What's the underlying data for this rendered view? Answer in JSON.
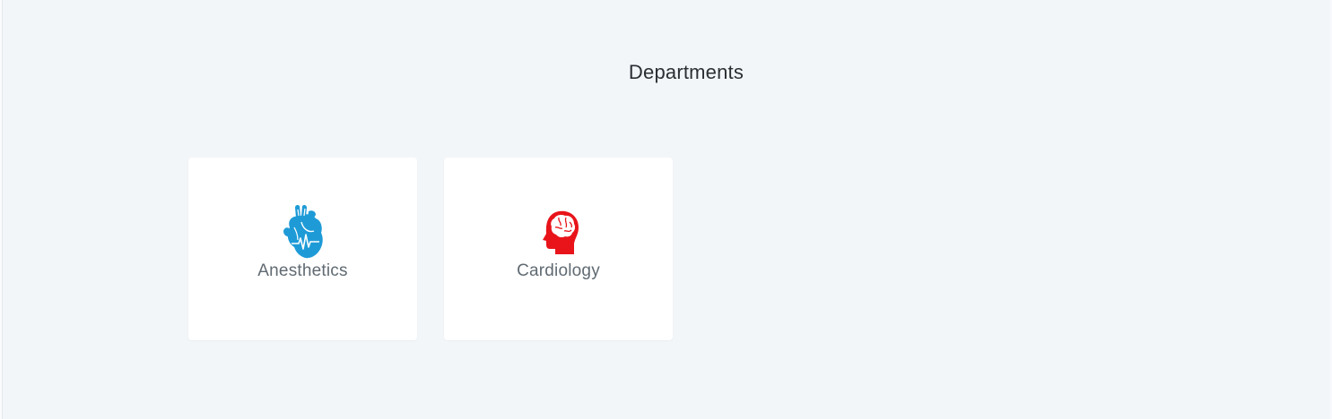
{
  "page": {
    "title": "Departments"
  },
  "departments": [
    {
      "label": "Anesthetics",
      "icon": "heart-icon",
      "color": "#1e9bd7"
    },
    {
      "label": "Cardiology",
      "icon": "brain-head-icon",
      "color": "#e8141a"
    }
  ]
}
